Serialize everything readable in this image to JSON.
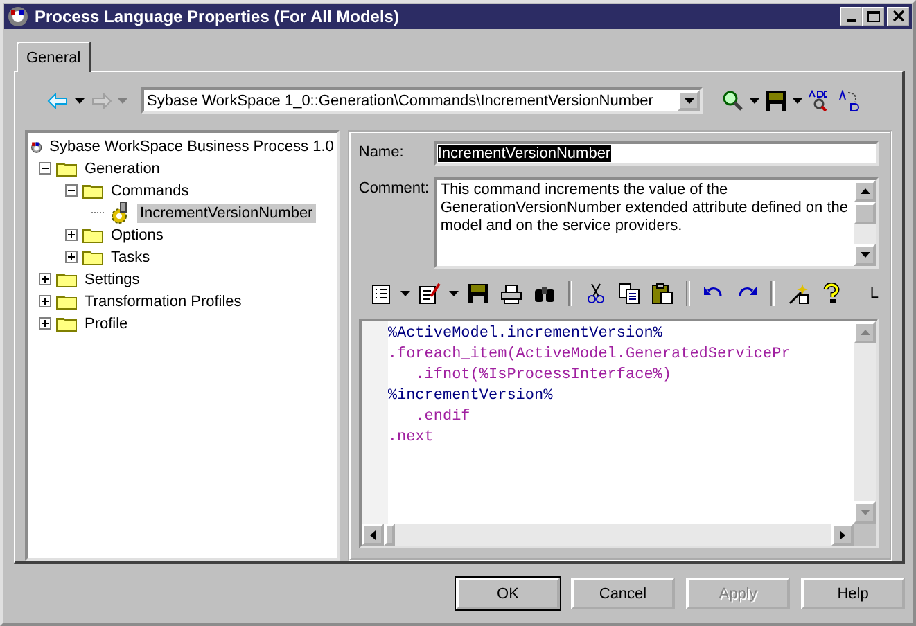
{
  "window": {
    "title": "Process Language Properties (For All Models)"
  },
  "tabs": [
    {
      "label": "General",
      "selected": true
    }
  ],
  "toolbar": {
    "nav": [
      {
        "kind": "back",
        "disabled": false
      },
      {
        "kind": "forward",
        "disabled": true
      }
    ],
    "path": "Sybase WorkSpace 1_0::Generation\\Commands\\IncrementVersionNumber"
  },
  "tree": {
    "label": "Sybase WorkSpace Business Process 1.0",
    "children": [
      {
        "label": "Generation",
        "kind": "folder",
        "expanded": true,
        "selected": false,
        "children": [
          {
            "label": "Commands",
            "kind": "folder",
            "expanded": true,
            "selected": false,
            "children": [
              {
                "label": "IncrementVersionNumber",
                "kind": "command",
                "selected": true
              }
            ]
          },
          {
            "label": "Options",
            "kind": "folder",
            "expanded": false,
            "selected": false
          },
          {
            "label": "Tasks",
            "kind": "folder",
            "expanded": false,
            "selected": false
          }
        ]
      },
      {
        "label": "Settings",
        "kind": "folder",
        "expanded": false,
        "selected": false
      },
      {
        "label": "Transformation Profiles",
        "kind": "folder",
        "expanded": false,
        "selected": false
      },
      {
        "label": "Profile",
        "kind": "folder",
        "expanded": false,
        "selected": false
      }
    ]
  },
  "form": {
    "name_label": "Name:",
    "name_value": "IncrementVersionNumber",
    "name_selected": true,
    "comment_label": "Comment:",
    "comment": "This command increments the value of the GenerationVersionNumber extended attribute defined on the model and on the service providers."
  },
  "editor_toolbar": {
    "trailing_text": "L"
  },
  "code": [
    {
      "text": "%ActiveModel.incrementVersion%",
      "kind": "variable"
    },
    {
      "text": ".foreach_item(ActiveModel.GeneratedServicePr",
      "kind": "directive"
    },
    {
      "text": "   .ifnot(%IsProcessInterface%)",
      "kind": "directive"
    },
    {
      "text": "%incrementVersion%",
      "kind": "variable"
    },
    {
      "text": "   .endif",
      "kind": "directive"
    },
    {
      "text": ".next",
      "kind": "directive"
    }
  ],
  "buttons": [
    {
      "label": "OK",
      "kind": "default",
      "disabled": false
    },
    {
      "label": "Cancel",
      "kind": "normal",
      "disabled": false
    },
    {
      "label": "Apply",
      "kind": "normal",
      "disabled": true
    },
    {
      "label": "Help",
      "kind": "normal",
      "disabled": false
    }
  ]
}
